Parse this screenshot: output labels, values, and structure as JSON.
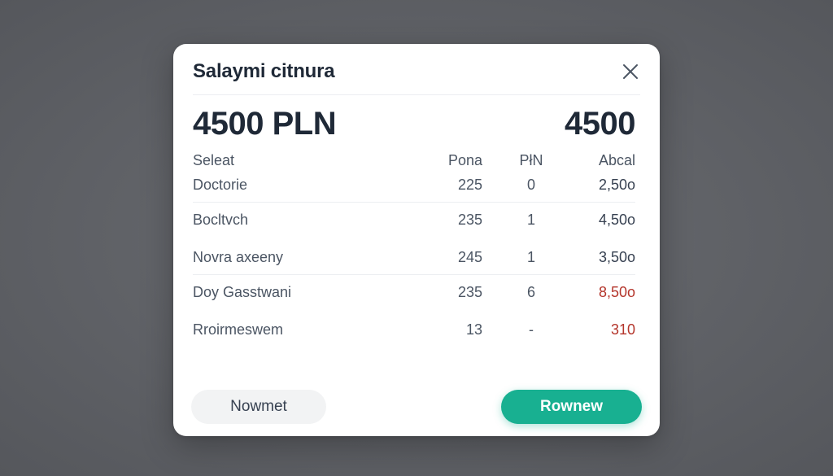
{
  "dialog": {
    "title": "Salaymi citnura",
    "total_left": "4500 PLN",
    "total_right": "4500",
    "close_icon": "close-icon"
  },
  "table": {
    "headers": [
      "Seleat",
      "Pona",
      "PłN",
      "Abcal"
    ],
    "rows": [
      {
        "name": "Doctorie",
        "a": "225",
        "b": "0",
        "c": "2,50o",
        "c_color": "#374151"
      },
      {
        "name": "Bocltvch",
        "a": "235",
        "b": "1",
        "c": "4,50o",
        "c_color": "#374151"
      },
      {
        "name": "Novra axeeny",
        "a": "245",
        "b": "1",
        "c": "3,50o",
        "c_color": "#374151"
      },
      {
        "name": "Doy Gasstwani",
        "a": "235",
        "b": "6",
        "c": "8,50o",
        "c_color": "#b4352b"
      },
      {
        "name": "Rroirmeswem",
        "a": "13",
        "b": "-",
        "c": "310",
        "c_color": "#b4352b"
      }
    ]
  },
  "buttons": {
    "secondary_label": "Nowmet",
    "primary_label": "Rownew"
  },
  "colors": {
    "accent": "#18b091",
    "negative": "#b4352b",
    "backdrop": "#5f6166"
  }
}
